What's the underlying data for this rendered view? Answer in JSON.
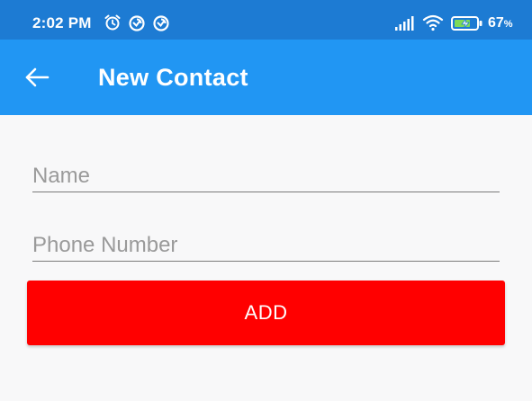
{
  "status_bar": {
    "time": "2:02 PM",
    "battery_value": "67",
    "battery_unit": "%",
    "icons": [
      "alarm-icon",
      "data-saver-icon",
      "data-saver-icon",
      "signal-icon",
      "wifi-icon",
      "battery-charging-icon"
    ]
  },
  "app_bar": {
    "title": "New Contact",
    "back_icon": "arrow-left-icon"
  },
  "form": {
    "name": {
      "placeholder": "Name",
      "value": ""
    },
    "phone": {
      "placeholder": "Phone Number",
      "value": ""
    },
    "add_label": "ADD"
  },
  "colors": {
    "status_bar": "#1d7bd3",
    "app_bar": "#2196f3",
    "background": "#f8f8f9",
    "add_button": "#ff0000",
    "underline": "#7a7a7a",
    "placeholder": "#9a9a9a"
  }
}
